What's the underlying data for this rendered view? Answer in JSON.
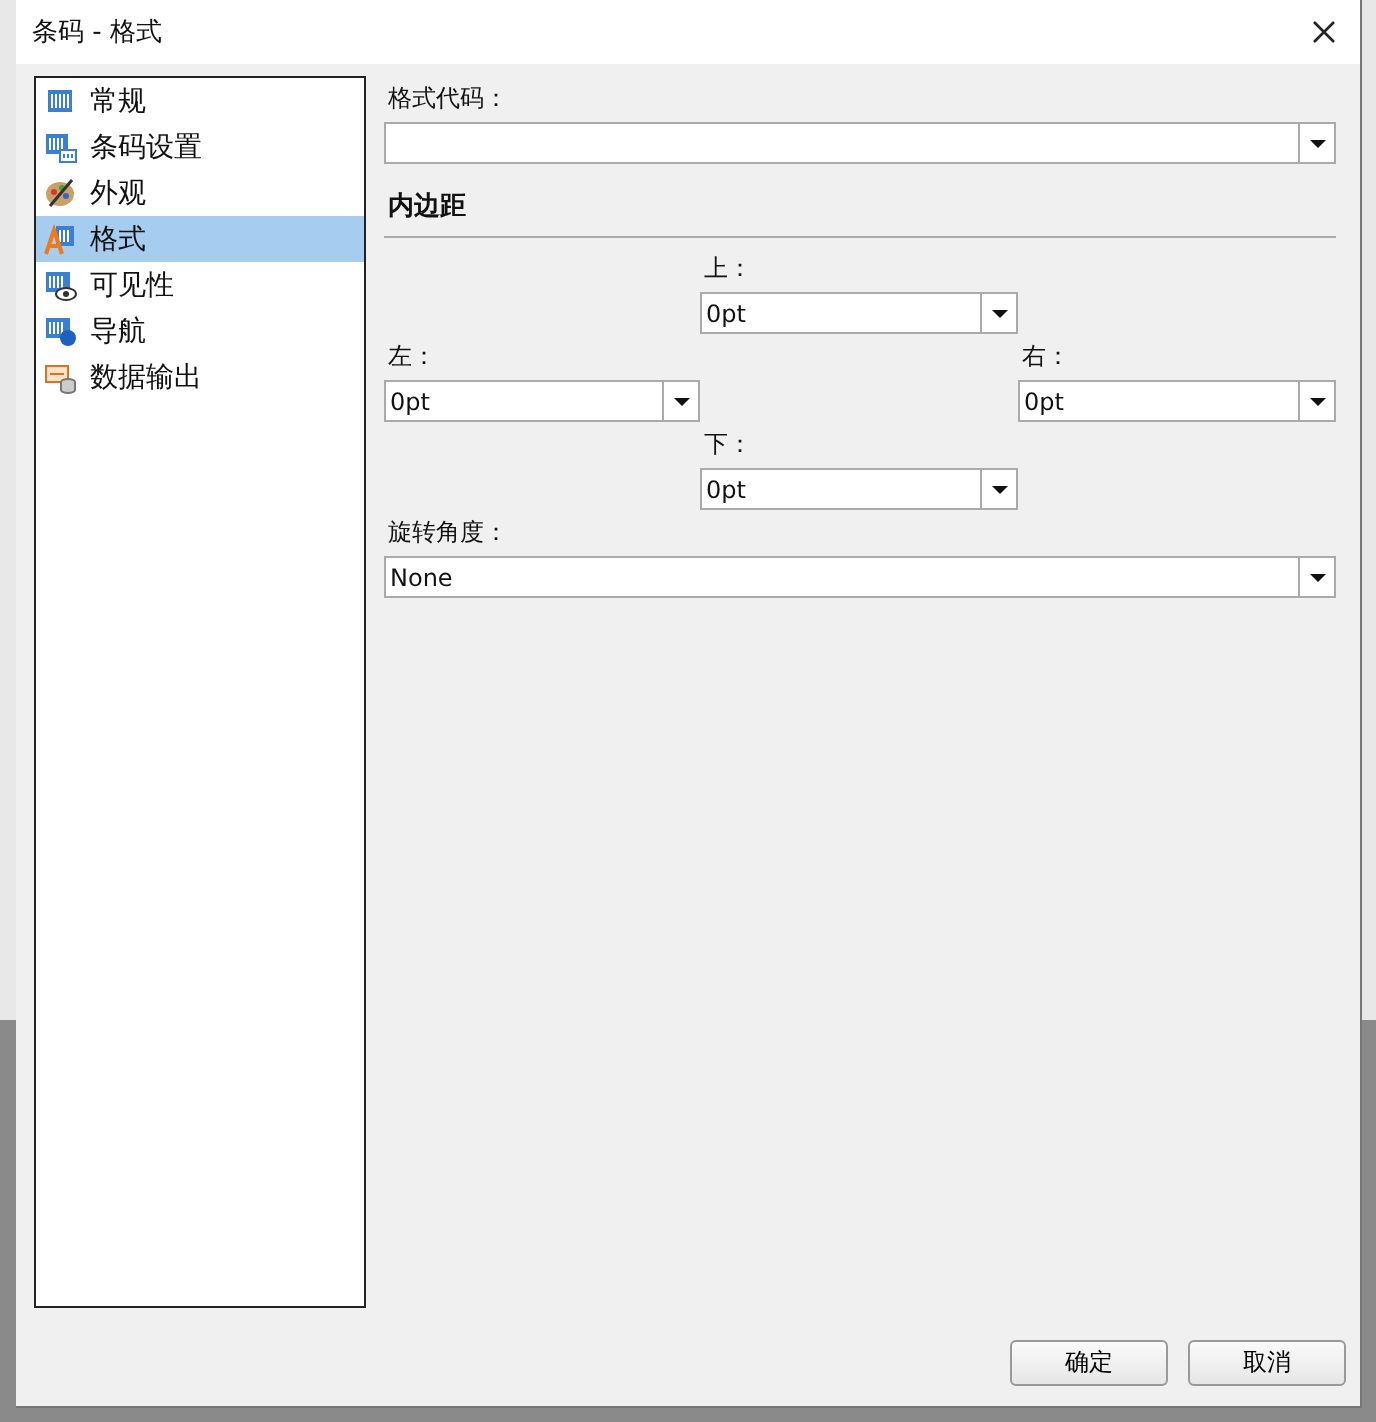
{
  "window": {
    "title": "条码 - 格式"
  },
  "sidebar": {
    "items": [
      {
        "label": "常规",
        "kind": "barcode",
        "selected": false
      },
      {
        "label": "条码设置",
        "kind": "settings",
        "selected": false
      },
      {
        "label": "外观",
        "kind": "palette",
        "selected": false
      },
      {
        "label": "格式",
        "kind": "format",
        "selected": true
      },
      {
        "label": "可见性",
        "kind": "visibility",
        "selected": false
      },
      {
        "label": "导航",
        "kind": "navigation",
        "selected": false
      },
      {
        "label": "数据输出",
        "kind": "output",
        "selected": false
      }
    ]
  },
  "format_code": {
    "label": "格式代码："
  },
  "padding": {
    "heading": "内边距",
    "top": {
      "label": "上：",
      "value": "0pt"
    },
    "left": {
      "label": "左：",
      "value": "0pt"
    },
    "right": {
      "label": "右：",
      "value": "0pt"
    },
    "bottom": {
      "label": "下：",
      "value": "0pt"
    }
  },
  "rotation": {
    "label": "旋转角度：",
    "value": "None"
  },
  "buttons": [
    "确定",
    "取消"
  ]
}
